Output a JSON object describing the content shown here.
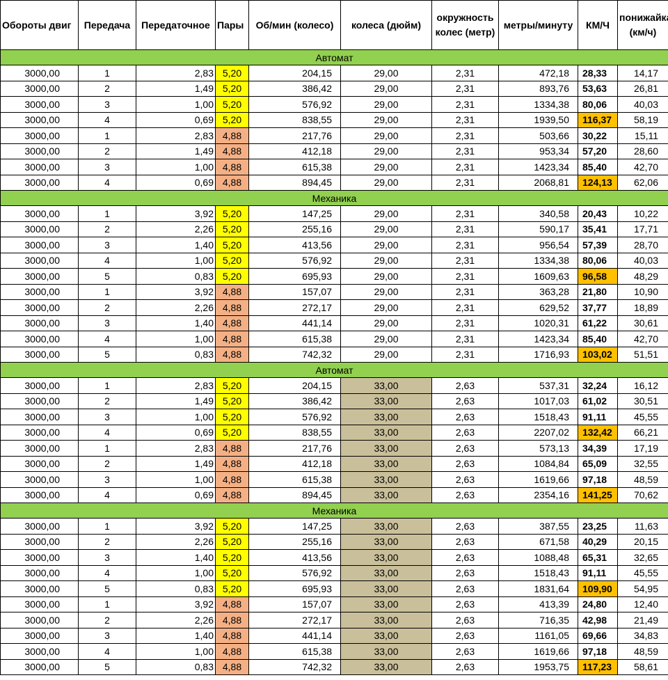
{
  "colors": {
    "section_header": "#92d050",
    "pair_5_20": "#ffff00",
    "pair_4_88": "#f4b084",
    "wheel_33": "#c9bf9a",
    "max_speed": "#ffc000"
  },
  "headers": [
    "Обороты двиг",
    "Передача",
    "Передаточное",
    "Пары",
    "Об/мин (колесо)",
    "колеса (дюйм)",
    "окружность колес (метр)",
    "метры/минуту",
    "КМ/Ч",
    "понижайка (км/ч)"
  ],
  "sections": [
    {
      "title": "Автомат",
      "rows": [
        [
          "3000,00",
          "1",
          "2,83",
          "5,20",
          "204,15",
          "29,00",
          "2,31",
          "472,18",
          "28,33",
          "14,17"
        ],
        [
          "3000,00",
          "2",
          "1,49",
          "5,20",
          "386,42",
          "29,00",
          "2,31",
          "893,76",
          "53,63",
          "26,81"
        ],
        [
          "3000,00",
          "3",
          "1,00",
          "5,20",
          "576,92",
          "29,00",
          "2,31",
          "1334,38",
          "80,06",
          "40,03"
        ],
        [
          "3000,00",
          "4",
          "0,69",
          "5,20",
          "838,55",
          "29,00",
          "2,31",
          "1939,50",
          "116,37",
          "58,19"
        ],
        [
          "3000,00",
          "1",
          "2,83",
          "4,88",
          "217,76",
          "29,00",
          "2,31",
          "503,66",
          "30,22",
          "15,11"
        ],
        [
          "3000,00",
          "2",
          "1,49",
          "4,88",
          "412,18",
          "29,00",
          "2,31",
          "953,34",
          "57,20",
          "28,60"
        ],
        [
          "3000,00",
          "3",
          "1,00",
          "4,88",
          "615,38",
          "29,00",
          "2,31",
          "1423,34",
          "85,40",
          "42,70"
        ],
        [
          "3000,00",
          "4",
          "0,69",
          "4,88",
          "894,45",
          "29,00",
          "2,31",
          "2068,81",
          "124,13",
          "62,06"
        ]
      ]
    },
    {
      "title": "Механика",
      "rows": [
        [
          "3000,00",
          "1",
          "3,92",
          "5,20",
          "147,25",
          "29,00",
          "2,31",
          "340,58",
          "20,43",
          "10,22"
        ],
        [
          "3000,00",
          "2",
          "2,26",
          "5,20",
          "255,16",
          "29,00",
          "2,31",
          "590,17",
          "35,41",
          "17,71"
        ],
        [
          "3000,00",
          "3",
          "1,40",
          "5,20",
          "413,56",
          "29,00",
          "2,31",
          "956,54",
          "57,39",
          "28,70"
        ],
        [
          "3000,00",
          "4",
          "1,00",
          "5,20",
          "576,92",
          "29,00",
          "2,31",
          "1334,38",
          "80,06",
          "40,03"
        ],
        [
          "3000,00",
          "5",
          "0,83",
          "5,20",
          "695,93",
          "29,00",
          "2,31",
          "1609,63",
          "96,58",
          "48,29"
        ],
        [
          "3000,00",
          "1",
          "3,92",
          "4,88",
          "157,07",
          "29,00",
          "2,31",
          "363,28",
          "21,80",
          "10,90"
        ],
        [
          "3000,00",
          "2",
          "2,26",
          "4,88",
          "272,17",
          "29,00",
          "2,31",
          "629,52",
          "37,77",
          "18,89"
        ],
        [
          "3000,00",
          "3",
          "1,40",
          "4,88",
          "441,14",
          "29,00",
          "2,31",
          "1020,31",
          "61,22",
          "30,61"
        ],
        [
          "3000,00",
          "4",
          "1,00",
          "4,88",
          "615,38",
          "29,00",
          "2,31",
          "1423,34",
          "85,40",
          "42,70"
        ],
        [
          "3000,00",
          "5",
          "0,83",
          "4,88",
          "742,32",
          "29,00",
          "2,31",
          "1716,93",
          "103,02",
          "51,51"
        ]
      ]
    },
    {
      "title": "Автомат",
      "rows": [
        [
          "3000,00",
          "1",
          "2,83",
          "5,20",
          "204,15",
          "33,00",
          "2,63",
          "537,31",
          "32,24",
          "16,12"
        ],
        [
          "3000,00",
          "2",
          "1,49",
          "5,20",
          "386,42",
          "33,00",
          "2,63",
          "1017,03",
          "61,02",
          "30,51"
        ],
        [
          "3000,00",
          "3",
          "1,00",
          "5,20",
          "576,92",
          "33,00",
          "2,63",
          "1518,43",
          "91,11",
          "45,55"
        ],
        [
          "3000,00",
          "4",
          "0,69",
          "5,20",
          "838,55",
          "33,00",
          "2,63",
          "2207,02",
          "132,42",
          "66,21"
        ],
        [
          "3000,00",
          "1",
          "2,83",
          "4,88",
          "217,76",
          "33,00",
          "2,63",
          "573,13",
          "34,39",
          "17,19"
        ],
        [
          "3000,00",
          "2",
          "1,49",
          "4,88",
          "412,18",
          "33,00",
          "2,63",
          "1084,84",
          "65,09",
          "32,55"
        ],
        [
          "3000,00",
          "3",
          "1,00",
          "4,88",
          "615,38",
          "33,00",
          "2,63",
          "1619,66",
          "97,18",
          "48,59"
        ],
        [
          "3000,00",
          "4",
          "0,69",
          "4,88",
          "894,45",
          "33,00",
          "2,63",
          "2354,16",
          "141,25",
          "70,62"
        ]
      ]
    },
    {
      "title": "Механика",
      "rows": [
        [
          "3000,00",
          "1",
          "3,92",
          "5,20",
          "147,25",
          "33,00",
          "2,63",
          "387,55",
          "23,25",
          "11,63"
        ],
        [
          "3000,00",
          "2",
          "2,26",
          "5,20",
          "255,16",
          "33,00",
          "2,63",
          "671,58",
          "40,29",
          "20,15"
        ],
        [
          "3000,00",
          "3",
          "1,40",
          "5,20",
          "413,56",
          "33,00",
          "2,63",
          "1088,48",
          "65,31",
          "32,65"
        ],
        [
          "3000,00",
          "4",
          "1,00",
          "5,20",
          "576,92",
          "33,00",
          "2,63",
          "1518,43",
          "91,11",
          "45,55"
        ],
        [
          "3000,00",
          "5",
          "0,83",
          "5,20",
          "695,93",
          "33,00",
          "2,63",
          "1831,64",
          "109,90",
          "54,95"
        ],
        [
          "3000,00",
          "1",
          "3,92",
          "4,88",
          "157,07",
          "33,00",
          "2,63",
          "413,39",
          "24,80",
          "12,40"
        ],
        [
          "3000,00",
          "2",
          "2,26",
          "4,88",
          "272,17",
          "33,00",
          "2,63",
          "716,35",
          "42,98",
          "21,49"
        ],
        [
          "3000,00",
          "3",
          "1,40",
          "4,88",
          "441,14",
          "33,00",
          "2,63",
          "1161,05",
          "69,66",
          "34,83"
        ],
        [
          "3000,00",
          "4",
          "1,00",
          "4,88",
          "615,38",
          "33,00",
          "2,63",
          "1619,66",
          "97,18",
          "48,59"
        ],
        [
          "3000,00",
          "5",
          "0,83",
          "4,88",
          "742,32",
          "33,00",
          "2,63",
          "1953,75",
          "117,23",
          "58,61"
        ]
      ]
    }
  ]
}
